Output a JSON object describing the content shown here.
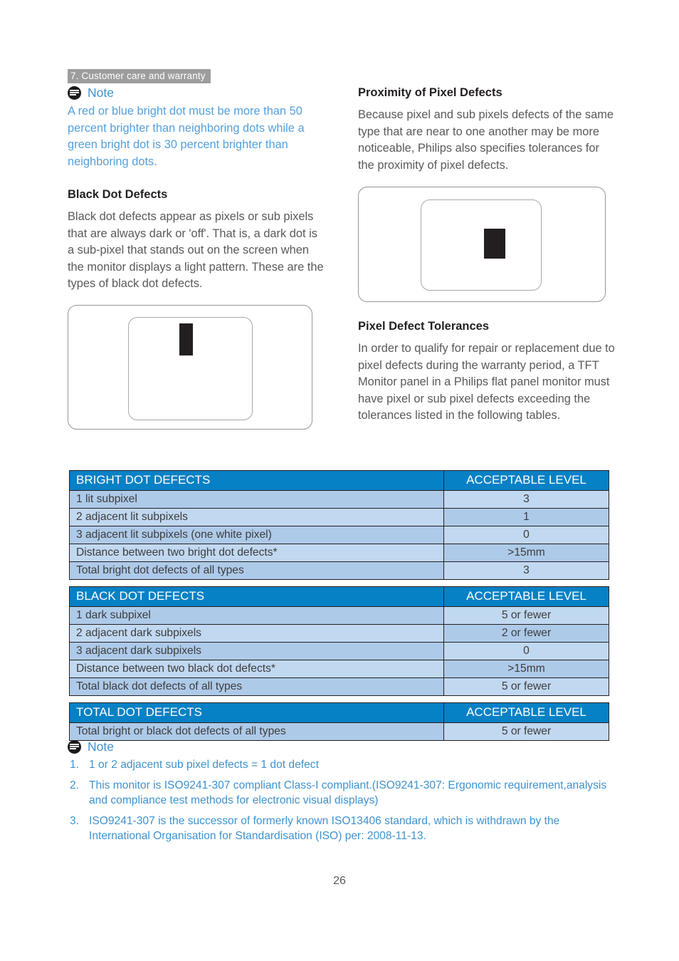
{
  "running_header": "7. Customer care and warranty",
  "page_number": "26",
  "colors": {
    "header_bar_bg": "#9d9d9d",
    "note_blue": "#54a0dd",
    "table_header_blue": "#0781c5",
    "row_dark": "#aecae9",
    "row_light": "#c1d8f1",
    "dot_black": "#231f20"
  },
  "note_top": {
    "icon": "note-icon",
    "title": "Note",
    "text": "A red or blue bright dot must be more than 50 percent brighter than neighboring dots while a green bright dot is 30 percent brighter than neighboring dots."
  },
  "left_column": {
    "black_dot_heading": "Black Dot Defects",
    "black_dot_text": "Black dot defects appear as pixels or sub pixels that are always dark or 'off'. That is, a dark dot is a sub-pixel that stands out on the screen when the monitor displays a light pattern. These are the types of black dot defects.",
    "figure_name": "black-dot-defect-illustration"
  },
  "right_column": {
    "proximity_heading": "Proximity of Pixel Defects",
    "proximity_text": "Because pixel and sub pixels defects of the same type that are near to one another may be more noticeable, Philips also specifies tolerances for the proximity of pixel defects.",
    "figure_name": "pixel-defect-proximity-illustration",
    "tolerances_heading": "Pixel Defect Tolerances",
    "tolerances_text": "In order to qualify for repair or replacement due to pixel defects during the warranty period, a TFT Monitor panel in a Philips flat panel monitor must have pixel or sub pixel defects exceeding the tolerances listed in the following tables."
  },
  "tables": [
    {
      "header": [
        "BRIGHT DOT DEFECTS",
        "ACCEPTABLE LEVEL"
      ],
      "rows": [
        [
          "1 lit subpixel",
          "3"
        ],
        [
          "2 adjacent lit subpixels",
          "1"
        ],
        [
          "3 adjacent lit subpixels (one white pixel)",
          "0"
        ],
        [
          "Distance between two bright dot defects*",
          ">15mm"
        ],
        [
          "Total bright dot defects of all types",
          "3"
        ]
      ]
    },
    {
      "header": [
        "BLACK DOT DEFECTS",
        "ACCEPTABLE LEVEL"
      ],
      "rows": [
        [
          "1 dark subpixel",
          "5 or fewer"
        ],
        [
          "2 adjacent dark subpixels",
          "2 or fewer"
        ],
        [
          "3 adjacent dark subpixels",
          "0"
        ],
        [
          "Distance between two black dot defects*",
          ">15mm"
        ],
        [
          "Total black dot defects of all types",
          "5 or fewer"
        ]
      ]
    },
    {
      "header": [
        "TOTAL DOT DEFECTS",
        "ACCEPTABLE LEVEL"
      ],
      "rows": [
        [
          "Total bright or black dot defects of all types",
          "5 or fewer"
        ]
      ]
    }
  ],
  "note_bottom": {
    "icon": "note-icon",
    "title": "Note",
    "items": [
      {
        "num": "1.",
        "text": "1 or 2 adjacent sub pixel defects = 1 dot defect"
      },
      {
        "num": "2.",
        "text": "This monitor is ISO9241-307 compliant Class-I compliant.(ISO9241-307: Ergonomic requirement,analysis and compliance test methods for electronic visual displays)"
      },
      {
        "num": "3.",
        "text": "ISO9241-307 is the successor of formerly known ISO13406 standard, which is withdrawn by the International Organisation for Standardisation (ISO) per: 2008-11-13."
      }
    ]
  }
}
